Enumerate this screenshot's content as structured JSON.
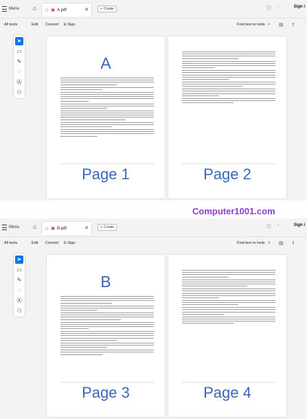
{
  "windows": [
    {
      "menu_label": "Menu",
      "tab_title": "A.pdf",
      "create_label": "Create",
      "sign_in": "Sign i",
      "menubar": [
        "All tools",
        "Edit",
        "Convert",
        "E-Sign"
      ],
      "find_label": "Find text or tools",
      "left_page": {
        "big_letter": "A",
        "label": "Page 1"
      },
      "right_page": {
        "label": "Page 2"
      }
    },
    {
      "menu_label": "Menu",
      "tab_title": "B.pdf",
      "create_label": "Create",
      "sign_in": "Sign i",
      "menubar": [
        "All tools",
        "Edit",
        "Convert",
        "E-Sign"
      ],
      "find_label": "Find text or tools",
      "left_page": {
        "big_letter": "B",
        "label": "Page 3"
      },
      "right_page": {
        "label": "Page 4"
      }
    }
  ],
  "watermark": "Computer1001.com",
  "icons": {
    "home": "home-icon",
    "star": "star-icon",
    "pdf": "pdf-file-icon",
    "close": "close-icon",
    "plus": "plus-icon",
    "help": "help-icon",
    "bell": "bell-icon",
    "search": "search-icon",
    "save": "save-icon",
    "share": "share-icon",
    "tools": [
      "cursor-icon",
      "comment-icon",
      "pen-icon",
      "lasso-icon",
      "text-icon",
      "stamp-icon"
    ]
  }
}
